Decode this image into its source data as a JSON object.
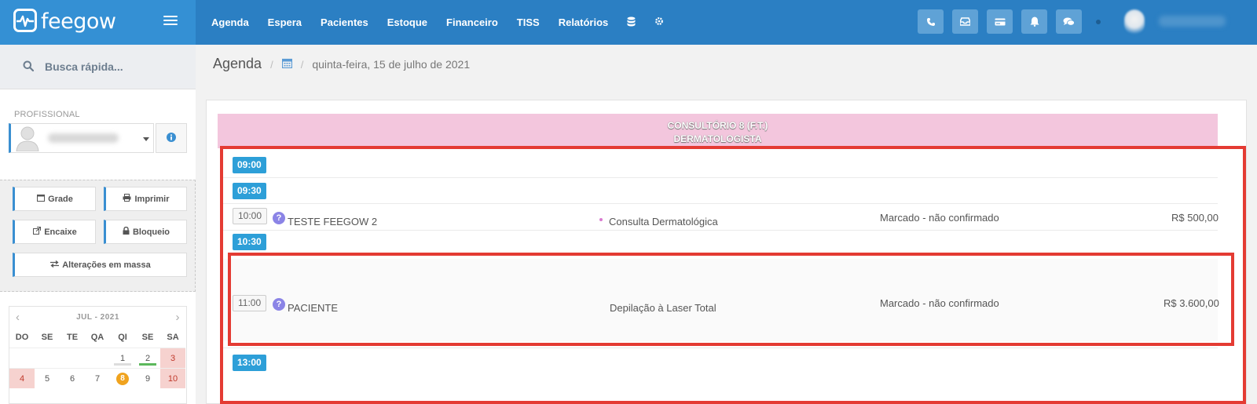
{
  "brand": {
    "name": "feegow"
  },
  "nav": {
    "items": [
      "Agenda",
      "Espera",
      "Pacientes",
      "Estoque",
      "Financeiro",
      "TISS",
      "Relatórios"
    ],
    "extra_icons": [
      "database-icon",
      "gear-icon"
    ]
  },
  "topbar": {
    "buttons": [
      "phone-icon",
      "inbox-icon",
      "card-icon",
      "bell-icon",
      "chat-icon"
    ]
  },
  "sidebar": {
    "search_placeholder": "Busca rápida...",
    "prof_label": "PROFISSIONAL",
    "tools": {
      "grade": "Grade",
      "imprimir": "Imprimir",
      "encaixe": "Encaixe",
      "bloqueio": "Bloqueio",
      "alteracoes": "Alterações em massa"
    },
    "calendar": {
      "month": "JUL - 2021",
      "dow": [
        "DO",
        "SE",
        "TE",
        "QA",
        "QI",
        "SE",
        "SA"
      ],
      "week1": [
        "",
        "",
        "",
        "",
        "1",
        "2",
        "3"
      ],
      "week2": [
        "4",
        "5",
        "6",
        "7",
        "8",
        "9",
        "10"
      ],
      "today": "8"
    }
  },
  "breadcrumb": {
    "title": "Agenda",
    "date": "quinta-feira, 15 de julho de 2021"
  },
  "schedule": {
    "room_line1": "CONSULTÓRIO 8 (F.T.)",
    "room_line2": "DERMATOLOGISTA",
    "slots": {
      "s0900": "09:00",
      "s0930": "09:30",
      "s1000": "10:00",
      "s1030": "10:30",
      "s1100": "11:00",
      "s1300": "13:00"
    },
    "appointments": [
      {
        "time": "10:00",
        "patient": "TESTE FEEGOW 2",
        "procedure": "Consulta Dermatológica",
        "status": "Marcado - não confirmado",
        "value": "R$ 500,00"
      },
      {
        "time": "11:00",
        "patient": "PACIENTE",
        "procedure": "Depilação à Laser Total",
        "status": "Marcado - não confirmado",
        "value": "R$ 3.600,00"
      }
    ]
  },
  "colors": {
    "topbar": "#2b7fc3",
    "accent": "#2d9fd8",
    "room_header": "#f3c6dd",
    "highlight": "#e43b33",
    "question": "#8b84e6"
  }
}
